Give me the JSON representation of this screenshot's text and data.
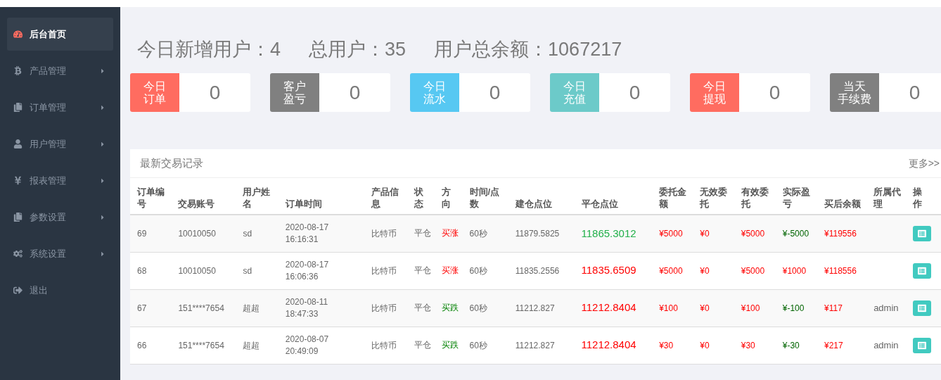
{
  "sidebar": {
    "items": [
      {
        "label": "后台首页",
        "kind": "dashboard",
        "selected": true,
        "has_submenu": false
      },
      {
        "label": "产品管理",
        "kind": "bitcoin",
        "selected": false,
        "has_submenu": true
      },
      {
        "label": "订单管理",
        "kind": "copy",
        "selected": false,
        "has_submenu": true
      },
      {
        "label": "用户管理",
        "kind": "user",
        "selected": false,
        "has_submenu": true
      },
      {
        "label": "报表管理",
        "kind": "yen",
        "selected": false,
        "has_submenu": true
      },
      {
        "label": "参数设置",
        "kind": "copy",
        "selected": false,
        "has_submenu": true
      },
      {
        "label": "系统设置",
        "kind": "cogs",
        "selected": false,
        "has_submenu": true
      },
      {
        "label": "退出",
        "kind": "logout",
        "selected": false,
        "has_submenu": false
      }
    ]
  },
  "summary": [
    "今日新增用户：4",
    "总用户：35",
    "用户总余额：1067217"
  ],
  "stat_cards": [
    {
      "label_lines": [
        "今日",
        "订单"
      ],
      "value": "0",
      "color": "#ff6c60"
    },
    {
      "label_lines": [
        "客户",
        "盈亏"
      ],
      "value": "0",
      "color": "#808080"
    },
    {
      "label_lines": [
        "今日",
        "流水"
      ],
      "value": "0",
      "color": "#57c8f2"
    },
    {
      "label_lines": [
        "今日",
        "充值"
      ],
      "value": "0",
      "color": "#6ccac9"
    },
    {
      "label_lines": [
        "今日",
        "提现"
      ],
      "value": "0",
      "color": "#ff6c60"
    },
    {
      "label_lines": [
        "当天",
        "手续费"
      ],
      "value": "0",
      "color": "#808080"
    }
  ],
  "trades": {
    "title": "最新交易记录",
    "more_link": "更多>>",
    "columns": [
      "订单编号",
      "交易账号",
      "用户姓名",
      "订单时间",
      "产品信息",
      "状态",
      "方向",
      "时间/点数",
      "建仓点位",
      "平仓点位",
      "委托金额",
      "无效委托",
      "有效委托",
      "实际盈亏",
      "买后余额",
      "所属代理",
      "操作"
    ],
    "rows": [
      {
        "id": "69",
        "account": "10010050",
        "name": "sd",
        "time": "2020-08-17 16:16:31",
        "product": "比特币",
        "status": "平仓",
        "direction": {
          "text": "买涨",
          "up": true
        },
        "duration": "60秒",
        "open_price": "11879.5825",
        "close_price": {
          "text": "11865.3012",
          "up": false
        },
        "amount": "¥5000",
        "invalid": "¥0",
        "valid": "¥5000",
        "pnl": {
          "text": "¥-5000",
          "up": false
        },
        "balance": "¥119556",
        "agent": ""
      },
      {
        "id": "68",
        "account": "10010050",
        "name": "sd",
        "time": "2020-08-17 16:06:36",
        "product": "比特币",
        "status": "平仓",
        "direction": {
          "text": "买涨",
          "up": true
        },
        "duration": "60秒",
        "open_price": "11835.2556",
        "close_price": {
          "text": "11835.6509",
          "up": true
        },
        "amount": "¥5000",
        "invalid": "¥0",
        "valid": "¥5000",
        "pnl": {
          "text": "¥1000",
          "up": true
        },
        "balance": "¥118556",
        "agent": ""
      },
      {
        "id": "67",
        "account": "151****7654",
        "name": "超超",
        "time": "2020-08-11 18:47:33",
        "product": "比特币",
        "status": "平仓",
        "direction": {
          "text": "买跌",
          "up": false
        },
        "duration": "60秒",
        "open_price": "11212.827",
        "close_price": {
          "text": "11212.8404",
          "up": true
        },
        "amount": "¥100",
        "invalid": "¥0",
        "valid": "¥100",
        "pnl": {
          "text": "¥-100",
          "up": false
        },
        "balance": "¥117",
        "agent": "admin"
      },
      {
        "id": "66",
        "account": "151****7654",
        "name": "超超",
        "time": "2020-08-07 20:49:09",
        "product": "比特币",
        "status": "平仓",
        "direction": {
          "text": "买跌",
          "up": false
        },
        "duration": "60秒",
        "open_price": "11212.827",
        "close_price": {
          "text": "11212.8404",
          "up": true
        },
        "amount": "¥30",
        "invalid": "¥0",
        "valid": "¥30",
        "pnl": {
          "text": "¥-30",
          "up": false
        },
        "balance": "¥217",
        "agent": "admin"
      }
    ]
  }
}
